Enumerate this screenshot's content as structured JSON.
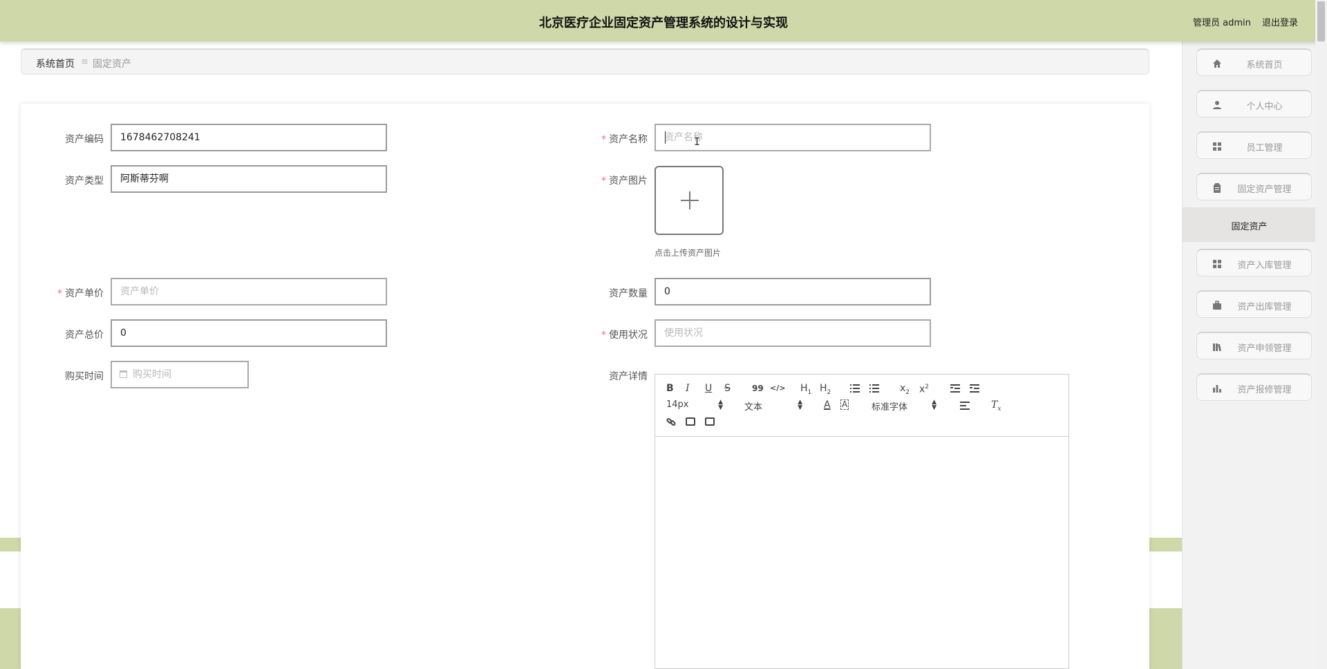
{
  "header": {
    "title": "北京医疗企业固定资产管理系统的设计与实现",
    "role": "管理员 admin",
    "logout": "退出登录"
  },
  "breadcrumb": {
    "home": "系统首页",
    "separator": "≡",
    "current": "固定资产"
  },
  "form": {
    "code": {
      "label": "资产编码",
      "value": "1678462708241"
    },
    "name": {
      "label": "资产名称",
      "placeholder": "资产名称"
    },
    "type": {
      "label": "资产类型",
      "value": "阿斯蒂芬啊"
    },
    "image": {
      "label": "资产图片",
      "tip": "点击上传资产图片"
    },
    "price": {
      "label": "资产单价",
      "placeholder": "资产单价"
    },
    "quantity": {
      "label": "资产数量",
      "value": "0"
    },
    "total": {
      "label": "资产总价",
      "value": "0"
    },
    "status": {
      "label": "使用状况",
      "placeholder": "使用状况"
    },
    "purchase_time": {
      "label": "购买时间",
      "placeholder": "购买时间"
    },
    "details": {
      "label": "资产详情"
    },
    "required_mark": "*"
  },
  "editor": {
    "bold": "B",
    "italic": "I",
    "underline": "U",
    "strike": "S",
    "quote": "99",
    "code": "</>",
    "h1": "H",
    "h1_sub": "1",
    "h2": "H",
    "h2_sub": "2",
    "sub_x": "x",
    "sub_2": "2",
    "sup_x": "x",
    "sup_2": "2",
    "font_size": "14px",
    "paragraph": "文本",
    "font_color": "A",
    "bg_color": "A",
    "font_family": "标准字体",
    "clear": "T",
    "clear_sub": "x"
  },
  "sidebar": {
    "items": [
      {
        "label": "系统首页",
        "icon": "home-icon"
      },
      {
        "label": "个人中心",
        "icon": "user-icon"
      },
      {
        "label": "员工管理",
        "icon": "grid-icon"
      },
      {
        "label": "固定资产管理",
        "icon": "clipboard-icon"
      },
      {
        "label": "资产入库管理",
        "icon": "grid-icon"
      },
      {
        "label": "资产出库管理",
        "icon": "briefcase-icon"
      },
      {
        "label": "资产申领管理",
        "icon": "books-icon"
      },
      {
        "label": "资产报修管理",
        "icon": "bar-chart-icon"
      }
    ],
    "active_sub": "固定资产"
  },
  "colors": {
    "header_bg": "#cfd8a8",
    "required": "#f56c6c",
    "sidebar_bg": "#f2f2f2",
    "active_sub_bg": "#e6e4e2"
  }
}
